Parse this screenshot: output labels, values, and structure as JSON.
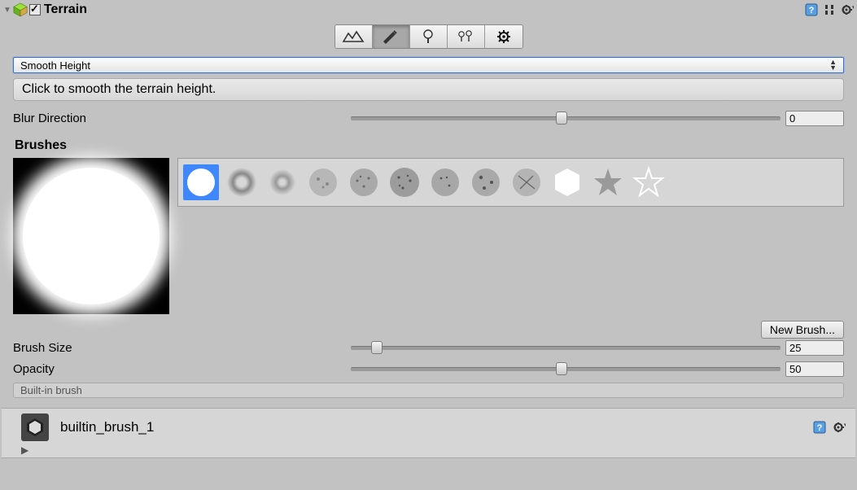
{
  "header": {
    "title": "Terrain",
    "checked": true
  },
  "tool_dropdown": {
    "selected": "Smooth Height"
  },
  "hint": "Click to smooth the terrain height.",
  "blur_direction": {
    "label": "Blur Direction",
    "value": "0",
    "percent": 49
  },
  "brushes_label": "Brushes",
  "new_brush_button": "New Brush...",
  "brush_size": {
    "label": "Brush Size",
    "value": "25",
    "percent": 6
  },
  "opacity": {
    "label": "Opacity",
    "value": "50",
    "percent": 49
  },
  "brush_info": "Built-in brush",
  "asset": {
    "name": "builtin_brush_1"
  }
}
